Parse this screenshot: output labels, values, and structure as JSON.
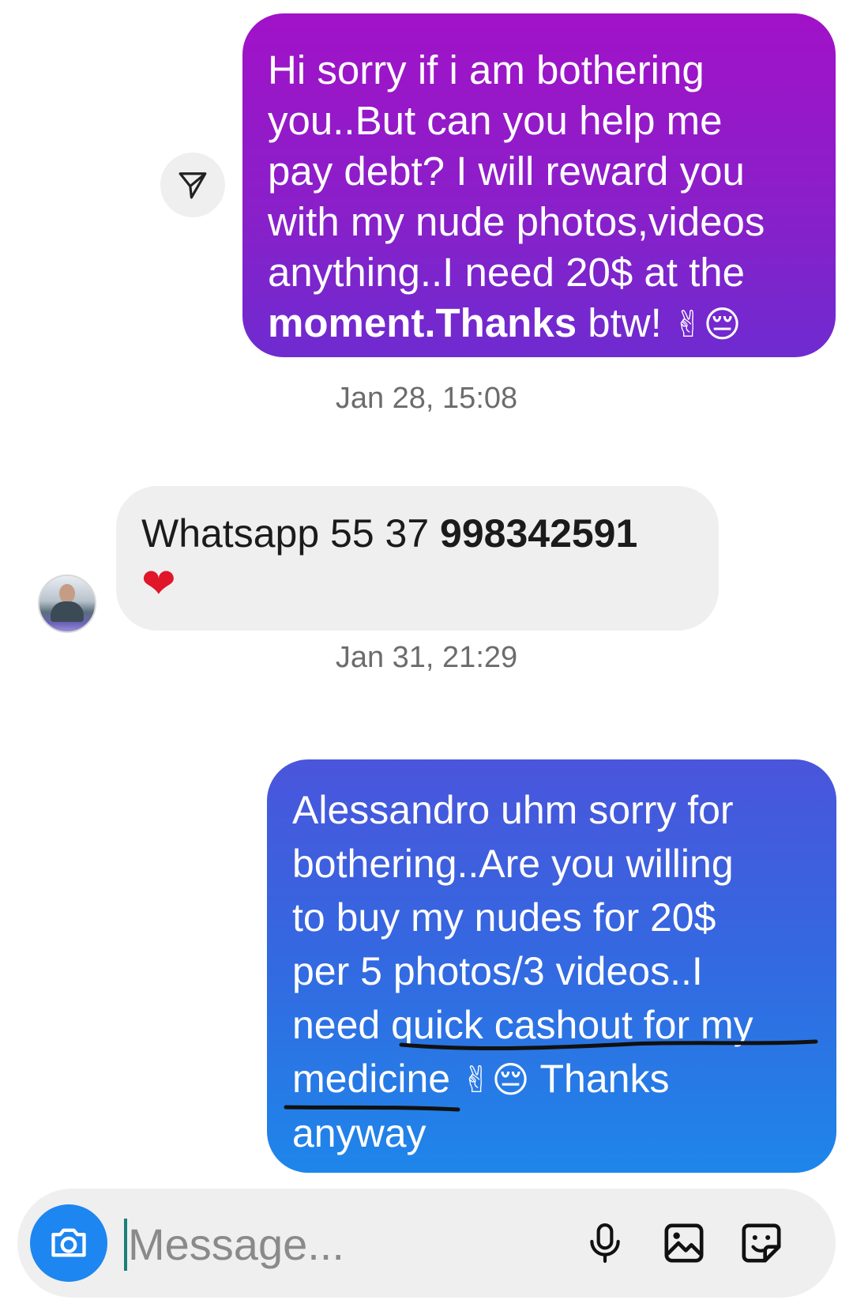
{
  "messages": [
    {
      "direction": "outgoing",
      "lines": [
        "Hi sorry if i am bothering",
        "you..But can you help me",
        "pay debt? I will reward you",
        "with my nude photos,videos",
        "anything..I need 20$ at the"
      ],
      "last_line_bold": "moment.Thanks",
      "last_line_rest": " btw! ",
      "emojis": "✌😔"
    },
    {
      "direction": "incoming",
      "prefix": "Whatsapp 55 37 ",
      "number": "998342591",
      "emoji": "❤"
    },
    {
      "direction": "outgoing",
      "lines": [
        "Alessandro uhm sorry for",
        "bothering..Are you willing",
        "to buy my nudes for 20$",
        "per 5 photos/3 videos..I",
        "need quick cashout for my"
      ],
      "line6_text": "medicine ",
      "line6_emojis": "✌😔",
      "line6_rest": " Thanks",
      "line7": "anyway"
    }
  ],
  "timestamps": [
    "Jan 28, 15:08",
    "Jan 31, 21:29"
  ],
  "composer": {
    "placeholder": "Message...",
    "icons": [
      "camera-icon",
      "microphone-icon",
      "gallery-icon",
      "sticker-icon"
    ],
    "camera_color": "#1d86f0"
  },
  "colors": {
    "bubble_purple": "#8b1fc9",
    "bubble_blue": "#3567e0",
    "bubble_gray": "#efefef",
    "underline": "#111111"
  }
}
